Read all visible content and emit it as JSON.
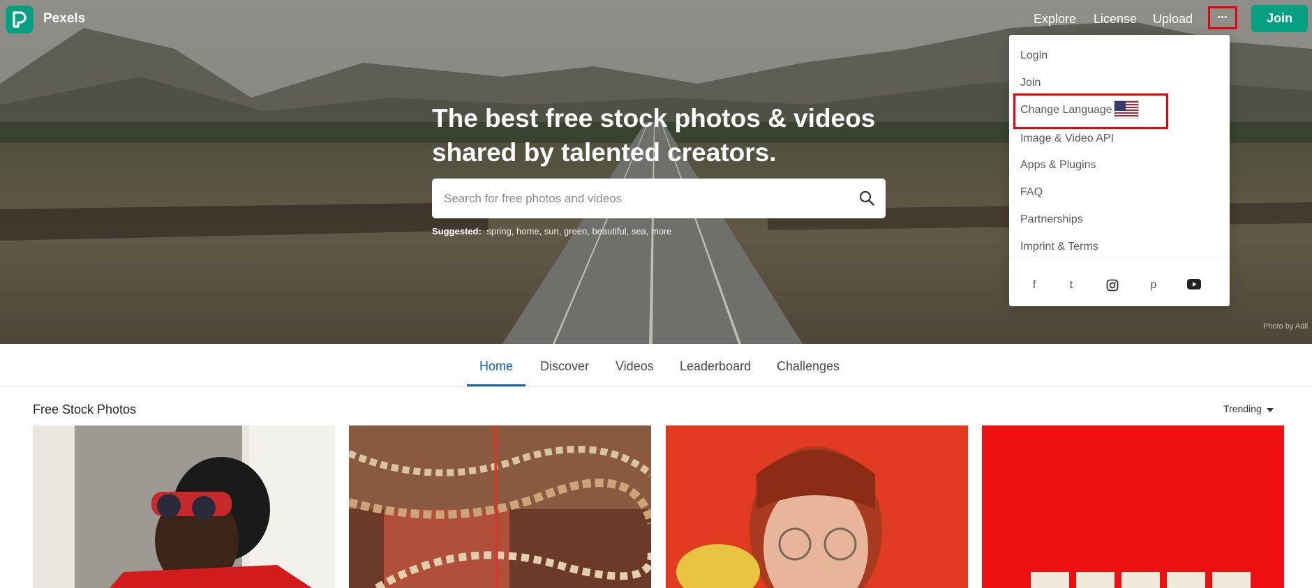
{
  "brand": {
    "name": "Pexels",
    "color": "#05a081"
  },
  "nav": {
    "links": [
      "Explore",
      "License",
      "Upload"
    ],
    "more_label": "•••",
    "join_label": "Join"
  },
  "hero": {
    "title_line1": "The best free stock photos & videos",
    "title_line2": "shared by talented creators.",
    "search_placeholder": "Search for free photos and videos",
    "suggested_label": "Suggested:",
    "suggested_tags": "spring, home, sun, green, beautiful, sea, more",
    "photo_credit": "Photo by Adil"
  },
  "dropdown": {
    "items": [
      "Login",
      "Join",
      "Change Language",
      "Image & Video API",
      "Apps & Plugins",
      "FAQ",
      "Partnerships",
      "Imprint & Terms"
    ],
    "social_icons": [
      "facebook-icon",
      "twitter-icon",
      "instagram-icon",
      "pinterest-icon",
      "youtube-icon"
    ],
    "social_glyphs": [
      "f",
      "t",
      "◎",
      "p",
      "▶"
    ]
  },
  "tabs": [
    "Home",
    "Discover",
    "Videos",
    "Leaderboard",
    "Challenges"
  ],
  "active_tab": "Home",
  "section": {
    "title": "Free Stock Photos",
    "sort_label": "Trending"
  },
  "colors": {
    "accent": "#0b5fc4",
    "highlight": "#e8000b"
  }
}
